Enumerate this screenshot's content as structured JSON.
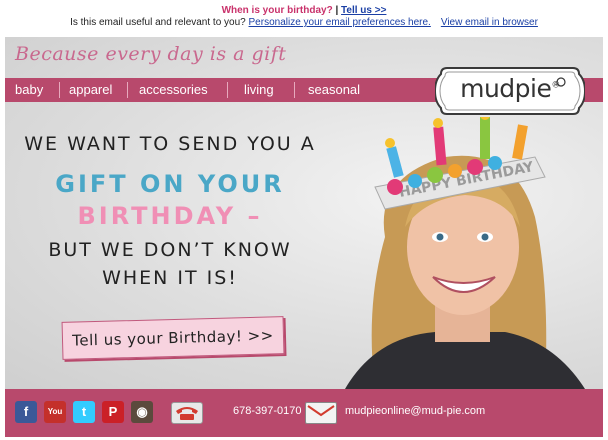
{
  "preheader": {
    "question": "When is your birthday?",
    "separator": " | ",
    "tell_us_link": "Tell us >>",
    "relevance_text": "Is this email useful and relevant to you?",
    "personalize_link": "Personalize your email preferences here.",
    "view_browser_link": "View email in browser"
  },
  "brand": {
    "tagline": "Because every day is a gift",
    "logo_text": "mudpie",
    "logo_mark": "®",
    "accent_color": "#b8496c"
  },
  "nav": {
    "items": [
      {
        "label": "baby"
      },
      {
        "label": "apparel"
      },
      {
        "label": "accessories"
      },
      {
        "label": "living"
      },
      {
        "label": "seasonal"
      }
    ]
  },
  "hero": {
    "line1": "WE WANT TO SEND YOU A",
    "line2": "GIFT ON YOUR",
    "line3": "BIRTHDAY –",
    "line4": "BUT WE DON’T KNOW",
    "line5": "WHEN IT IS!",
    "cta_label": "Tell us your Birthday! >>",
    "crown_text": "HAPPY BIRTHDAY"
  },
  "footer": {
    "social_icons": [
      "facebook-icon",
      "youtube-icon",
      "twitter-icon",
      "pinterest-icon",
      "instagram-icon"
    ],
    "phone": "678-397-0170",
    "email": "mudpieonline@mud-pie.com"
  }
}
